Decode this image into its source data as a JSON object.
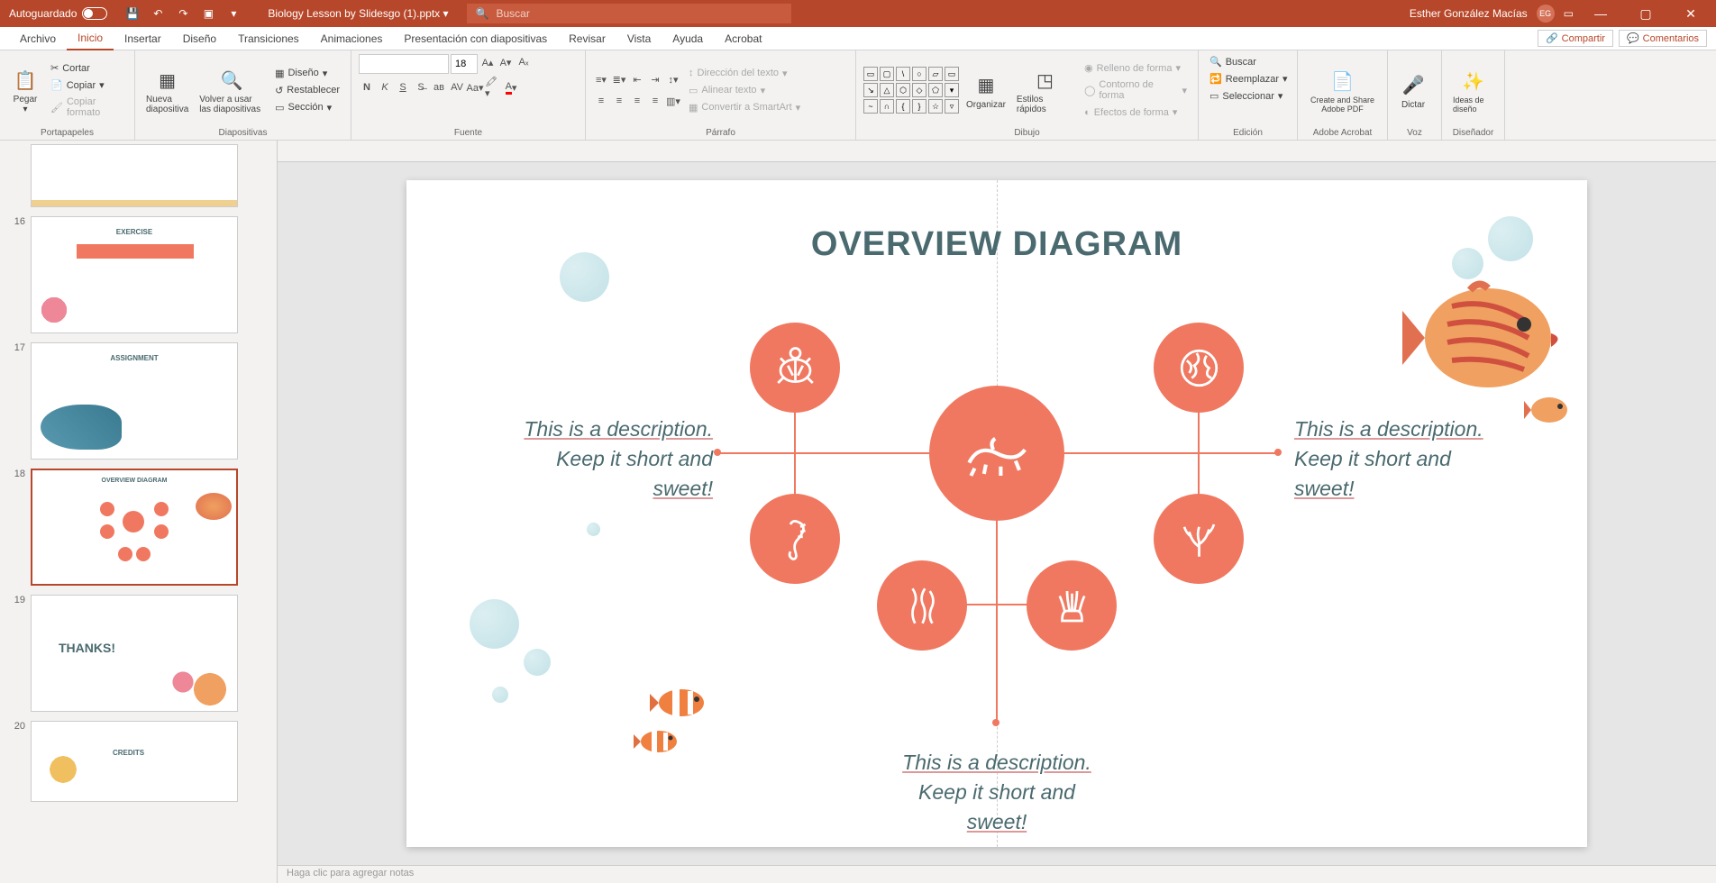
{
  "titlebar": {
    "autosave": "Autoguardado",
    "filename": "Biology Lesson by Slidesgo (1).pptx",
    "search_placeholder": "Buscar",
    "username": "Esther González Macías",
    "initials": "EG"
  },
  "tabs": {
    "archivo": "Archivo",
    "inicio": "Inicio",
    "insertar": "Insertar",
    "diseno": "Diseño",
    "transiciones": "Transiciones",
    "animaciones": "Animaciones",
    "presentacion": "Presentación con diapositivas",
    "revisar": "Revisar",
    "vista": "Vista",
    "ayuda": "Ayuda",
    "acrobat": "Acrobat",
    "compartir": "Compartir",
    "comentarios": "Comentarios"
  },
  "ribbon": {
    "pegar": "Pegar",
    "cortar": "Cortar",
    "copiar": "Copiar",
    "copiar_formato": "Copiar formato",
    "portapapeles": "Portapapeles",
    "nueva_diapositiva": "Nueva diapositiva",
    "volver_usar": "Volver a usar las diapositivas",
    "diseno_btn": "Diseño",
    "restablecer": "Restablecer",
    "seccion": "Sección",
    "diapositivas": "Diapositivas",
    "font_size": "18",
    "fuente": "Fuente",
    "parrafo": "Párrafo",
    "direccion_texto": "Dirección del texto",
    "alinear_texto": "Alinear texto",
    "convertir_smartart": "Convertir a SmartArt",
    "organizar": "Organizar",
    "estilos_rapidos": "Estilos rápidos",
    "relleno_forma": "Relleno de forma",
    "contorno_forma": "Contorno de forma",
    "efectos_forma": "Efectos de forma",
    "dibujo": "Dibujo",
    "buscar": "Buscar",
    "reemplazar": "Reemplazar",
    "seleccionar": "Seleccionar",
    "edicion": "Edición",
    "create_share": "Create and Share Adobe PDF",
    "adobe_acrobat": "Adobe Acrobat",
    "dictar": "Dictar",
    "voz": "Voz",
    "ideas_diseno": "Ideas de diseño",
    "disenador": "Diseñador"
  },
  "slide": {
    "title": "OVERVIEW DIAGRAM",
    "desc_left_1": "This is a description.",
    "desc_left_2": "Keep it short and",
    "desc_left_3": "sweet!",
    "desc_right_1": "This is a description.",
    "desc_right_2": "Keep it short and",
    "desc_right_3": "sweet!",
    "desc_bottom_1": "This is a description.",
    "desc_bottom_2": "Keep it short and",
    "desc_bottom_3": "sweet!"
  },
  "thumbs": {
    "n16": "16",
    "n17": "17",
    "n18": "18",
    "n19": "19",
    "n20": "20",
    "t16_title": "EXERCISE",
    "t17_title": "ASSIGNMENT",
    "t19_title": "THANKS!",
    "t20_title": "CREDITS"
  },
  "notes": "Haga clic para agregar notas"
}
